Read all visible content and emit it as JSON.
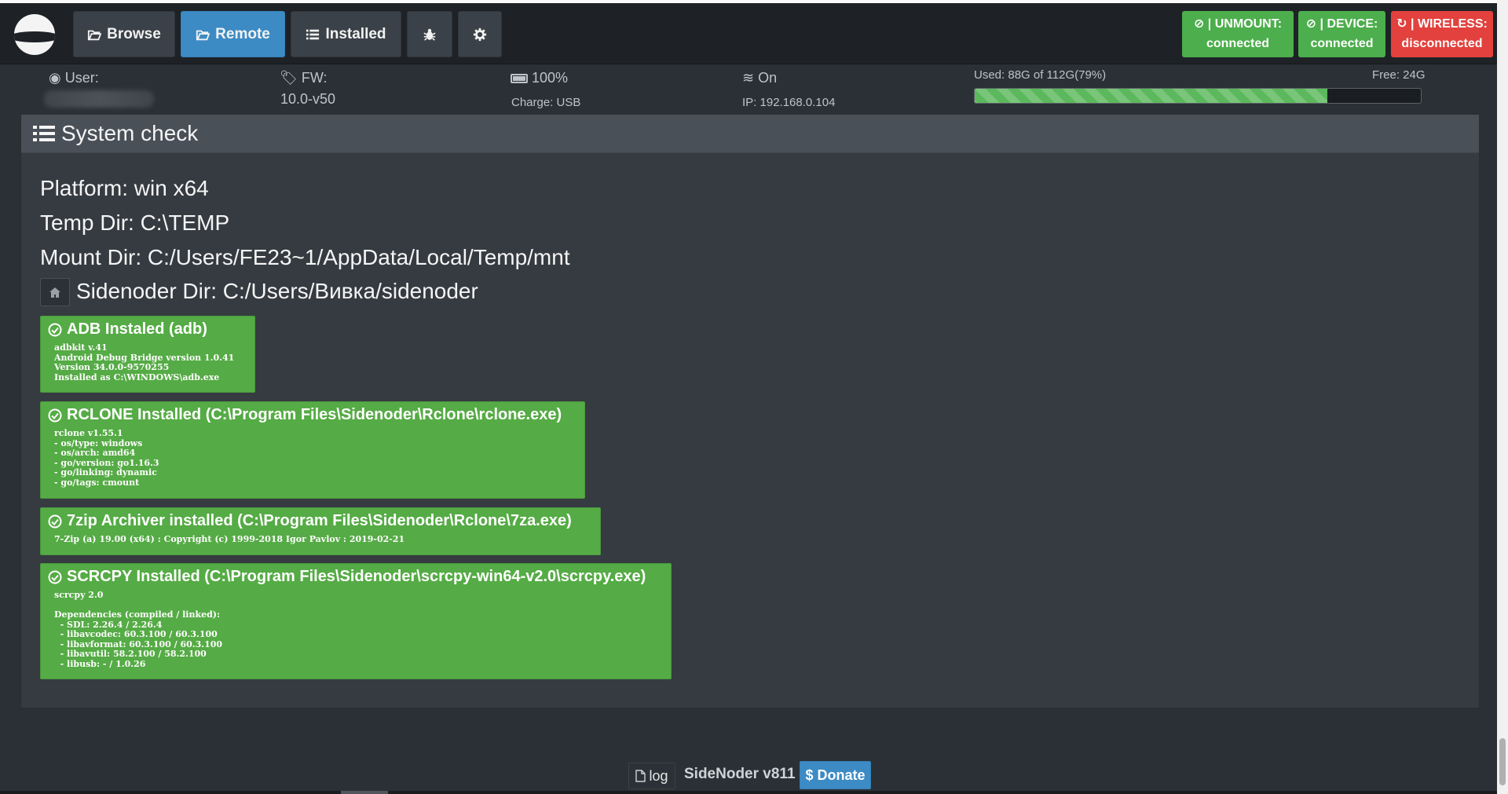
{
  "navbar": {
    "browse_label": "Browse",
    "remote_label": "Remote",
    "installed_label": "Installed",
    "status": [
      {
        "line1": "| UNMOUNT:",
        "line2": "connected",
        "state": "ok"
      },
      {
        "line1": "| DEVICE:",
        "line2": "connected",
        "state": "ok"
      },
      {
        "line1": "| WIRELESS:",
        "line2": "disconnected",
        "state": "bad"
      }
    ]
  },
  "info": {
    "user_label": "User:",
    "fw_label": "FW:",
    "fw_value": "10.0-v50",
    "battery_value": "100%",
    "charge_text": "Charge: USB",
    "wifi_value": "On",
    "ip_text": "IP: 192.168.0.104",
    "storage_used": "Used: 88G of 112G(79%)",
    "storage_free": "Free: 24G",
    "storage_percent": 79
  },
  "panel": {
    "title": "System check",
    "platform": "Platform: win x64",
    "temp_dir": "Temp Dir: C:\\TEMP",
    "mount_dir": "Mount Dir: C:/Users/FE23~1/AppData/Local/Temp/mnt",
    "sidenoder_dir": "Sidenoder Dir: C:/Users/Вивка/sidenoder",
    "checks": [
      {
        "title": "ADB Instaled (adb)",
        "details": "adbkit v.41\nAndroid Debug Bridge version 1.0.41\nVersion 34.0.0-9570255\nInstalled as C:\\WINDOWS\\adb.exe"
      },
      {
        "title": "RCLONE Installed (C:\\Program Files\\Sidenoder\\Rclone\\rclone.exe)",
        "details": "rclone v1.55.1\n- os/type: windows\n- os/arch: amd64\n- go/version: go1.16.3\n- go/linking: dynamic\n- go/tags: cmount"
      },
      {
        "title": "7zip Archiver installed (C:\\Program Files\\Sidenoder\\Rclone\\7za.exe)",
        "details": "7-Zip (a) 19.00 (x64) : Copyright (c) 1999-2018 Igor Pavlov : 2019-02-21"
      },
      {
        "title": "SCRCPY Installed (C:\\Program Files\\Sidenoder\\scrcpy-win64-v2.0\\scrcpy.exe)",
        "details": "scrcpy 2.0\n\nDependencies (compiled / linked):\n  - SDL: 2.26.4 / 2.26.4\n  - libavcodec: 60.3.100 / 60.3.100\n  - libavformat: 60.3.100 / 60.3.100\n  - libavutil: 58.2.100 / 58.2.100\n  - libusb: - / 1.0.26"
      }
    ]
  },
  "footer": {
    "log_label": "log",
    "version": "SideNoder v811",
    "donate_label": "$ Donate"
  }
}
